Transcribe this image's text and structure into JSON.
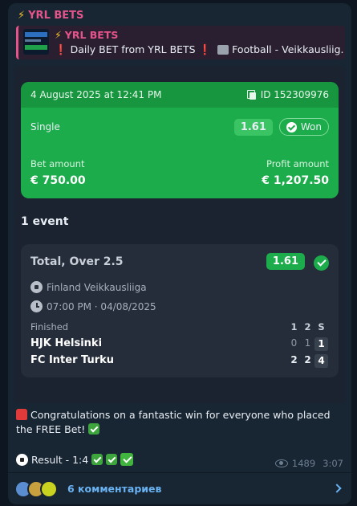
{
  "post": {
    "sender": "YRL BETS",
    "reply": {
      "title": "YRL BETS",
      "text_prefix": "Daily BET from YRL BETS",
      "text_suffix": "Football - Veikkausliig..."
    }
  },
  "bet_card": {
    "datetime": "4 August 2025 at 12:41 PM",
    "id_label": "ID 152309976",
    "type": "Single",
    "odds": "1.61",
    "status": "Won",
    "bet_amount_label": "Bet amount",
    "bet_amount": "€ 750.00",
    "profit_amount_label": "Profit amount",
    "profit_amount": "€ 1,207.50",
    "events_title": "1 event",
    "event": {
      "market": "Total, Over 2.5",
      "odds": "1.61",
      "league": "Finland Veikkausliiga",
      "time": "07:00 PM · 04/08/2025",
      "status": "Finished",
      "score_headers": [
        "1",
        "2",
        "S"
      ],
      "teams": [
        {
          "name": "HJK Helsinki",
          "scores": [
            "0",
            "1"
          ],
          "total": "1"
        },
        {
          "name": "FC Inter Turku",
          "scores": [
            "2",
            "2"
          ],
          "total": "4"
        }
      ]
    }
  },
  "message": {
    "line1": "Congratulations on a fantastic win for everyone who placed the FREE Bet!",
    "result": "Result - 1:4",
    "views": "1489",
    "time": "3:07"
  },
  "comments": {
    "label": "6 комментариев"
  },
  "colors": {
    "accent_green": "#1cac4b",
    "sender_pink": "#e5548a",
    "link_blue": "#6ab3f3"
  }
}
